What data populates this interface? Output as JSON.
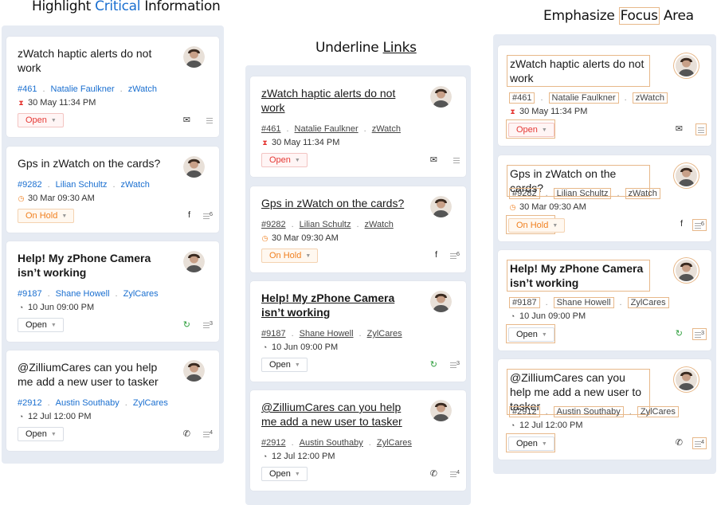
{
  "headings": {
    "p1": {
      "pre": "Highlight ",
      "accent": "Critical",
      "post": " Information"
    },
    "p2": {
      "pre": "Underline ",
      "accent": "Links"
    },
    "p3": {
      "pre": "Emphasize ",
      "accent": "Focus",
      "post": " Area"
    }
  },
  "tickets": [
    {
      "title": "zWatch haptic alerts do not work",
      "bold": false,
      "id": "#461",
      "contact": "Natalie Faulkner",
      "dept": "zWatch",
      "date": "30 May 11:34 PM",
      "date_icon": "hourglass-icon",
      "status": "Open",
      "status_style": "open-red",
      "channel_icon": "email-icon",
      "channel_glyph": "✉",
      "thread_count": ""
    },
    {
      "title": "Gps in zWatch on the cards?",
      "bold": false,
      "id": "#9282",
      "contact": "Lilian Schultz",
      "dept": "zWatch",
      "date": "30 Mar 09:30 AM",
      "date_icon": "timer-icon",
      "status": "On Hold",
      "status_style": "onhold",
      "channel_icon": "facebook-icon",
      "channel_glyph": "f",
      "thread_count": "6"
    },
    {
      "title": "Help! My zPhone Camera isn’t working",
      "bold": true,
      "id": "#9187",
      "contact": "Shane Howell",
      "dept": "ZylCares",
      "date": "10 Jun 09:00 PM",
      "date_icon": "clock-icon",
      "status": "Open",
      "status_style": "open",
      "channel_icon": "chat-icon",
      "channel_glyph": "↻",
      "thread_count": "3"
    },
    {
      "title": "@ZilliumCares can you help me add a new user to tasker",
      "bold": false,
      "id": "#2912",
      "contact": "Austin Southaby",
      "dept": "ZylCares",
      "date": "12 Jul 12:00 PM",
      "date_icon": "clock-icon",
      "status": "Open",
      "status_style": "open",
      "channel_icon": "phone-icon",
      "channel_glyph": "✆",
      "thread_count": "4"
    }
  ],
  "colors": {
    "link": "#1a6fd0",
    "focus_border": "#e7b88a",
    "panel_bg": "#e6ebf3"
  }
}
